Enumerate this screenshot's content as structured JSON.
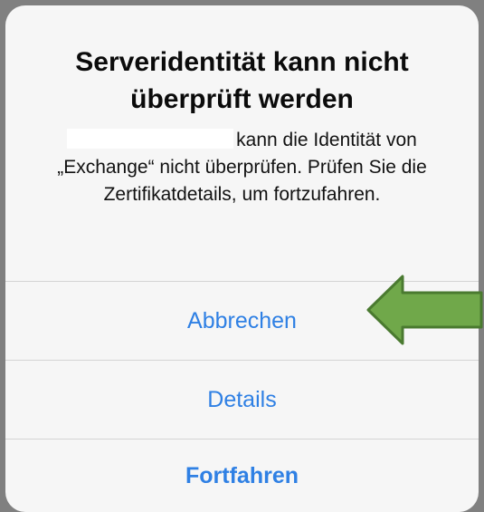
{
  "alert": {
    "title": "Serveridentität kann nicht überprüft werden",
    "message": "kann die Identität von „Exchange“ nicht überprüfen. Prüfen Sie die Zertifikatdetails, um fortzufahren.",
    "buttons": {
      "cancel": "Abbrechen",
      "details": "Details",
      "continue": "Fortfahren"
    }
  },
  "annotation": {
    "arrow_color": "#70a84a",
    "arrow_border": "#4a7a30"
  },
  "colors": {
    "button_text": "#2f80e4",
    "background": "#f6f6f6",
    "separator": "#d4d4d4"
  }
}
